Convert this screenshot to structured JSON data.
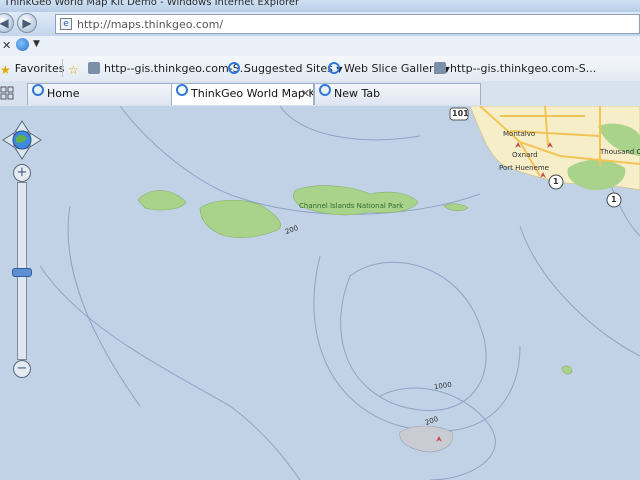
{
  "window": {
    "title": "ThinkGeo World Map Kit Demo - Windows Internet Explorer"
  },
  "address_bar": {
    "url": "http://maps.thinkgeo.com/"
  },
  "favorites_bar": {
    "favorites_label": "Favorites",
    "items": [
      {
        "label": "http--gis.thinkgeo.com-S...",
        "icon": "page-icon"
      },
      {
        "label": "Suggested Sites",
        "icon": "ie-icon"
      },
      {
        "label": "Web Slice Gallery",
        "icon": "ie-icon"
      },
      {
        "label": "http--gis.thinkgeo.com-S...",
        "icon": "page-icon"
      }
    ]
  },
  "tabs": [
    {
      "label": "Home"
    },
    {
      "label": "ThinkGeo World Map Ki..."
    },
    {
      "label": "New Tab"
    }
  ],
  "map": {
    "park_label": "Channel Islands National Park",
    "depth_labels": [
      "200",
      "1000",
      "200"
    ],
    "city_labels": [
      "Montalvo",
      "Oxnard",
      "Port Hueneme",
      "Thousand Oak"
    ],
    "highway_shields": [
      "101",
      "1",
      "1"
    ],
    "colors": {
      "ocean": "#c2d2e6",
      "island": "#a9d38a",
      "land": "#f6eec8",
      "roads": "#f2c458"
    }
  }
}
